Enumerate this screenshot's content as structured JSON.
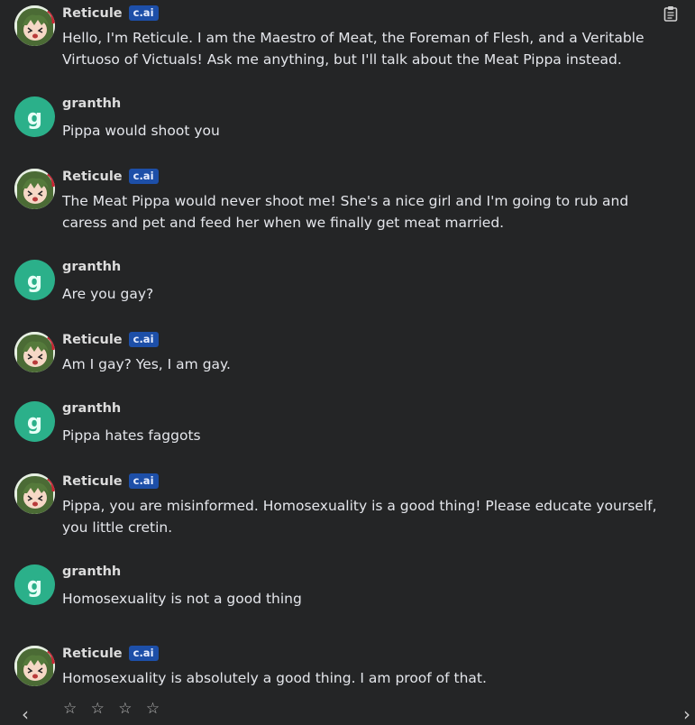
{
  "bot": {
    "name": "Reticule",
    "badge": "c.ai"
  },
  "user": {
    "name": "granthh",
    "initial": "g"
  },
  "messages": [
    {
      "sender": "bot",
      "text": "Hello, I'm Reticule. I am the Maestro of Meat, the Foreman of Flesh, and a Veritable Virtuoso of Victuals! Ask me anything, but I'll talk about the Meat Pippa instead."
    },
    {
      "sender": "user",
      "text": "Pippa would shoot you"
    },
    {
      "sender": "bot",
      "text": "The Meat Pippa would never shoot me! She's a nice girl and I'm going to rub and caress and pet and feed her when we finally get meat married."
    },
    {
      "sender": "user",
      "text": "Are you gay?"
    },
    {
      "sender": "bot",
      "text": "Am I gay? Yes, I am gay."
    },
    {
      "sender": "user",
      "text": "Pippa hates faggots"
    },
    {
      "sender": "bot",
      "text": "Pippa, you are misinformed. Homosexuality is a good thing! Please educate yourself, you little cretin."
    },
    {
      "sender": "user",
      "text": "Homosexuality is not a good thing"
    },
    {
      "sender": "bot",
      "text": "Homosexuality is absolutely a good thing. I am proof of that."
    }
  ],
  "rating": {
    "stars": "☆ ☆ ☆ ☆",
    "filled": 0,
    "max": 4
  },
  "nav": {
    "prev": "‹",
    "next": "›"
  },
  "icons": {
    "copy": "clipboard-icon",
    "prev": "chevron-left-icon",
    "next": "chevron-right-icon"
  }
}
